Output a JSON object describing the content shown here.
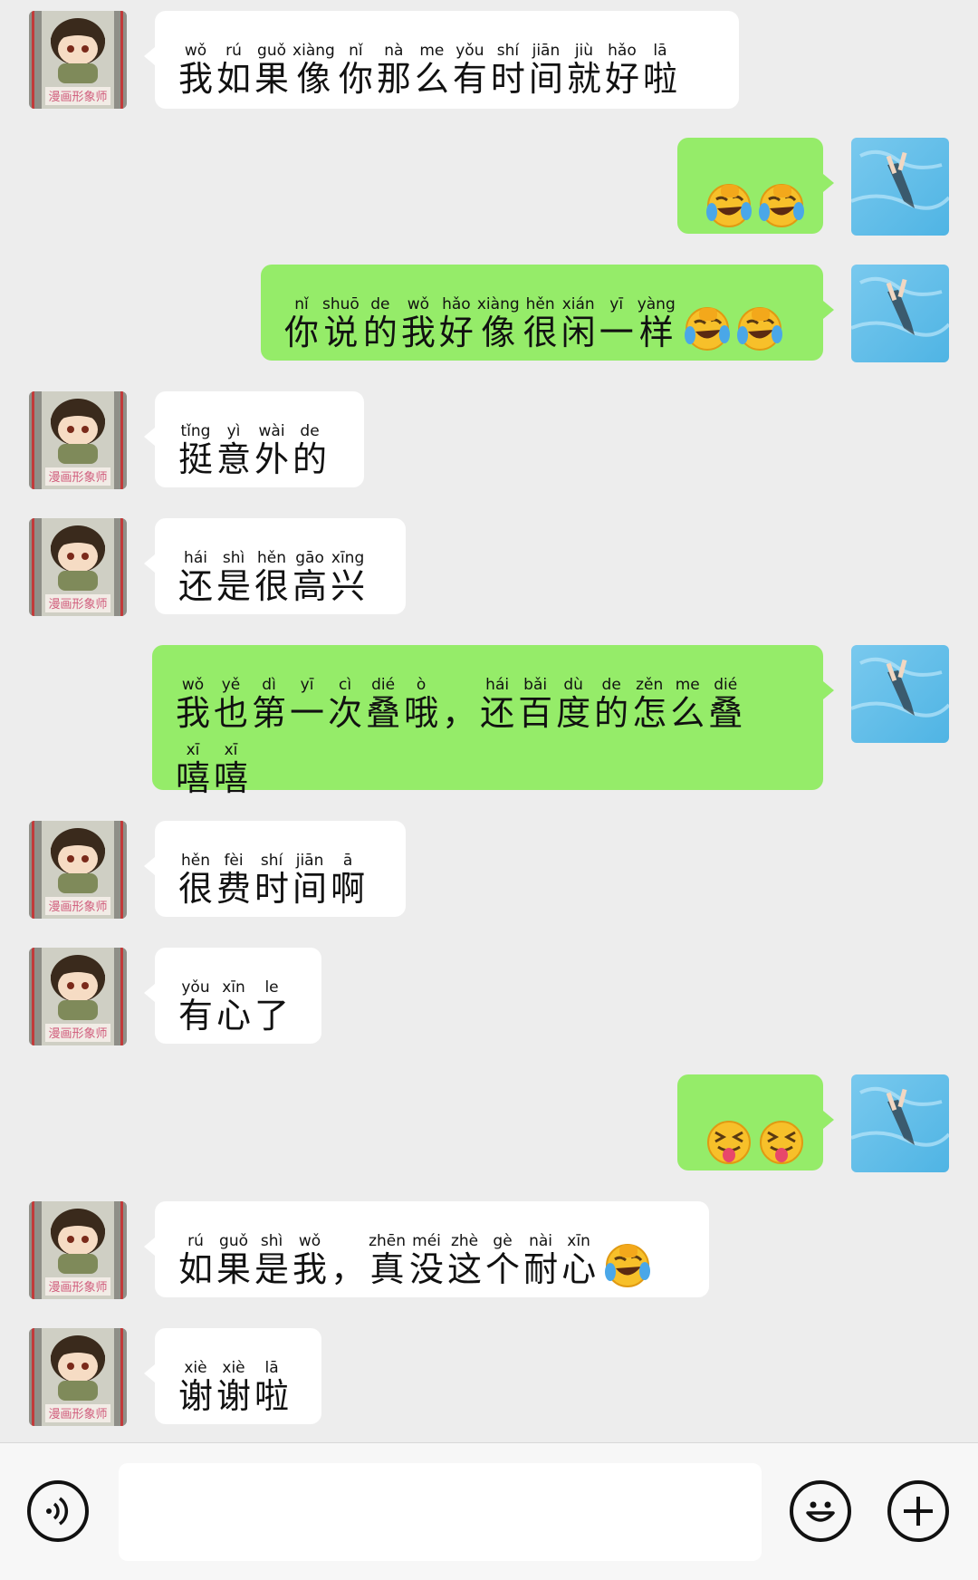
{
  "messages": [
    {
      "side": "in",
      "words": [
        [
          "我",
          "wǒ"
        ],
        [
          "如",
          "rú"
        ],
        [
          "果",
          "guǒ"
        ],
        [
          "像",
          "xiàng"
        ],
        [
          "你",
          "nǐ"
        ],
        [
          "那",
          "nà"
        ],
        [
          "么",
          "me"
        ],
        [
          "有",
          "yǒu"
        ],
        [
          "时",
          "shí"
        ],
        [
          "间",
          "jiān"
        ],
        [
          "就",
          "jiù"
        ],
        [
          "好",
          "hǎo"
        ],
        [
          "啦",
          "lā"
        ]
      ]
    },
    {
      "side": "out",
      "emoji": [
        "tears-of-joy-emoji",
        "tears-of-joy-emoji"
      ]
    },
    {
      "side": "out",
      "words": [
        [
          "你",
          "nǐ"
        ],
        [
          "说",
          "shuō"
        ],
        [
          "的",
          "de"
        ],
        [
          "我",
          "wǒ"
        ],
        [
          "好",
          "hǎo"
        ],
        [
          "像",
          "xiàng"
        ],
        [
          "很",
          "hěn"
        ],
        [
          "闲",
          "xián"
        ],
        [
          "一",
          "yī"
        ],
        [
          "样",
          "yàng"
        ]
      ],
      "emoji": [
        "tears-of-joy-emoji",
        "tears-of-joy-emoji"
      ]
    },
    {
      "side": "in",
      "words": [
        [
          "挺",
          "tǐng"
        ],
        [
          "意",
          "yì"
        ],
        [
          "外",
          "wài"
        ],
        [
          "的",
          "de"
        ]
      ]
    },
    {
      "side": "in",
      "words": [
        [
          "还",
          "hái"
        ],
        [
          "是",
          "shì"
        ],
        [
          "很",
          "hěn"
        ],
        [
          "高",
          "gāo"
        ],
        [
          "兴",
          "xīng"
        ]
      ]
    },
    {
      "side": "out",
      "words": [
        [
          "我",
          "wǒ"
        ],
        [
          "也",
          "yě"
        ],
        [
          "第",
          "dì"
        ],
        [
          "一",
          "yī"
        ],
        [
          "次",
          "cì"
        ],
        [
          "叠",
          "dié"
        ],
        [
          "哦",
          "ò"
        ],
        [
          "，",
          ""
        ],
        [
          "还",
          "hái"
        ],
        [
          "百",
          "bǎi"
        ],
        [
          "度",
          "dù"
        ],
        [
          "的",
          "de"
        ],
        [
          "怎",
          "zěn"
        ],
        [
          "么",
          "me"
        ],
        [
          "叠",
          "dié"
        ]
      ],
      "words2": [
        [
          "嘻",
          "xī"
        ],
        [
          "嘻",
          "xī"
        ]
      ]
    },
    {
      "side": "in",
      "words": [
        [
          "很",
          "hěn"
        ],
        [
          "费",
          "fèi"
        ],
        [
          "时",
          "shí"
        ],
        [
          "间",
          "jiān"
        ],
        [
          "啊",
          "ā"
        ]
      ]
    },
    {
      "side": "in",
      "words": [
        [
          "有",
          "yǒu"
        ],
        [
          "心",
          "xīn"
        ],
        [
          "了",
          "le"
        ]
      ]
    },
    {
      "side": "out",
      "emoji": [
        "squinting-tongue-emoji",
        "squinting-tongue-emoji"
      ]
    },
    {
      "side": "in",
      "words": [
        [
          "如",
          "rú"
        ],
        [
          "果",
          "guǒ"
        ],
        [
          "是",
          "shì"
        ],
        [
          "我",
          "wǒ"
        ],
        [
          "，",
          ""
        ],
        [
          "真",
          "zhēn"
        ],
        [
          "没",
          "méi"
        ],
        [
          "这",
          "zhè"
        ],
        [
          "个",
          "gè"
        ],
        [
          "耐",
          "nài"
        ],
        [
          "心",
          "xīn"
        ]
      ],
      "emoji": [
        "tears-of-joy-emoji"
      ]
    },
    {
      "side": "in",
      "words": [
        [
          "谢",
          "xiè"
        ],
        [
          "谢",
          "xiè"
        ],
        [
          "啦",
          "lā"
        ]
      ]
    }
  ],
  "contact_avatar_caption": "漫画形象师",
  "input_bar": {
    "text_value": "",
    "voice_icon": "voice-icon",
    "emoji_icon": "emoji-face-icon",
    "plus_icon": "plus-icon"
  },
  "colors": {
    "background": "#ededed",
    "incoming_bubble": "#ffffff",
    "outgoing_bubble": "#95ec69"
  }
}
